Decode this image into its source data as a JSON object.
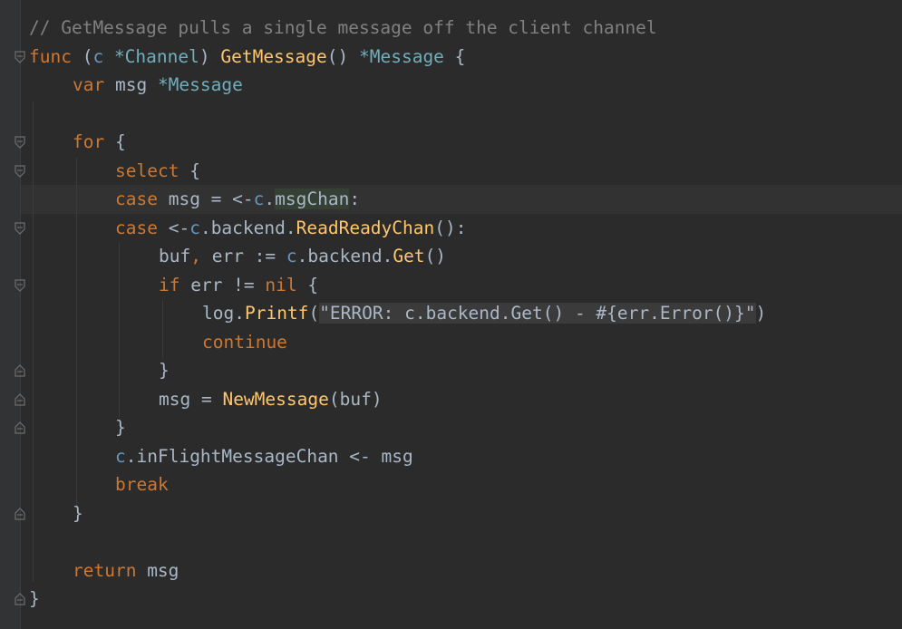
{
  "colors": {
    "background": "#2b2b2b",
    "gutter": "#313335",
    "keyword": "#cc7832",
    "function": "#ffc66d",
    "type": "#6fafbd",
    "comment": "#808080",
    "text": "#a9b7c6"
  },
  "code": {
    "line1": {
      "comment": "// GetMessage pulls a single message off the client channel"
    },
    "line2": {
      "func_kw": "func",
      "open_paren": " (",
      "recv": "c",
      "ptr_type": " *Channel",
      "close_paren": ") ",
      "fn_name": "GetMessage",
      "params": "() ",
      "ret_type": "*Message",
      "brace": " {"
    },
    "line3": {
      "var_kw": "var",
      "name": " msg ",
      "type": "*Message"
    },
    "line5": {
      "for_kw": "for",
      "brace": " {"
    },
    "line6": {
      "select_kw": "select",
      "brace": " {"
    },
    "line7": {
      "case_kw": "case",
      "text1": " msg = <-",
      "recv": "c",
      "dot": ".",
      "field": "msgChan",
      "colon": ":"
    },
    "line8": {
      "case_kw": "case",
      "text1": " <-",
      "recv": "c",
      "text2": ".backend.",
      "method": "ReadReadyChan",
      "text3": "():"
    },
    "line9": {
      "text1": "buf",
      "comma": ",",
      "text2": " err := ",
      "recv": "c",
      "text3": ".backend.",
      "method": "Get",
      "text4": "()"
    },
    "line10": {
      "if_kw": "if",
      "text1": " err != ",
      "nil_kw": "nil",
      "brace": " {"
    },
    "line11": {
      "pkg": "log",
      "dot": ".",
      "method": "Printf",
      "open": "(",
      "string": "\"ERROR: c.backend.Get() - #{err.Error()}\"",
      "close": ")"
    },
    "line12": {
      "continue_kw": "continue"
    },
    "line13": {
      "brace": "}"
    },
    "line14": {
      "text1": "msg = ",
      "fn": "NewMessage",
      "text2": "(buf)"
    },
    "line15": {
      "brace": "}"
    },
    "line16": {
      "recv": "c",
      "text1": ".inFlightMessageChan <- msg"
    },
    "line17": {
      "break_kw": "break"
    },
    "line18": {
      "brace": "}"
    },
    "line20": {
      "return_kw": "return",
      "text1": " msg"
    },
    "line21": {
      "brace": "}"
    }
  }
}
